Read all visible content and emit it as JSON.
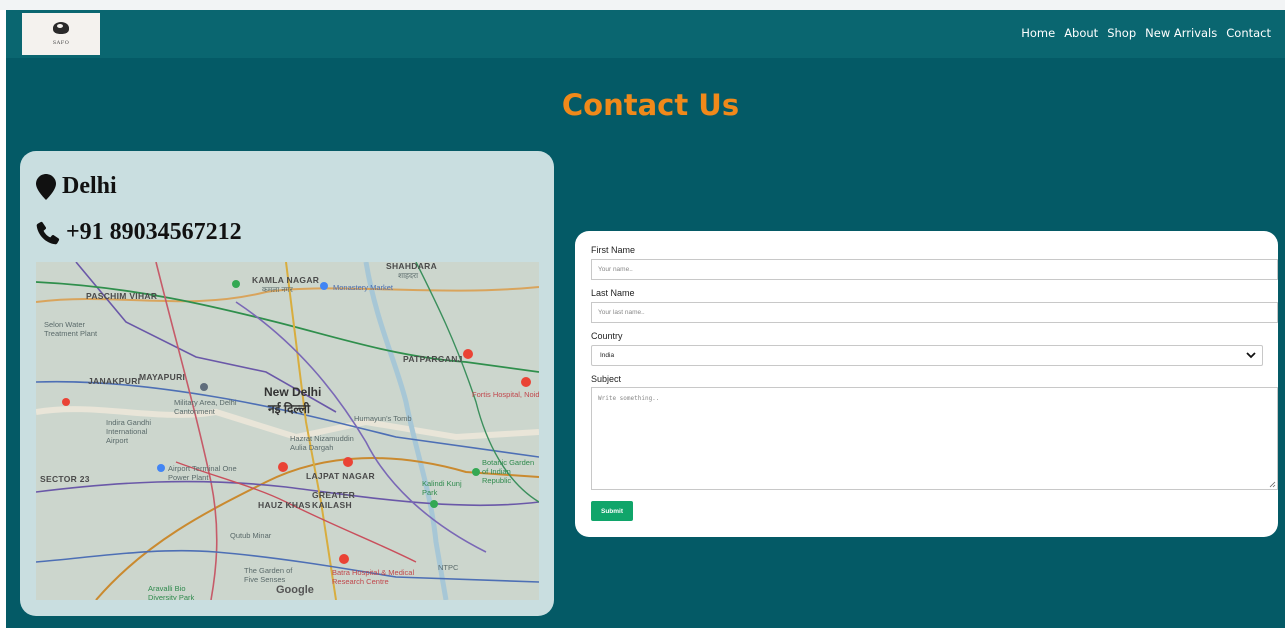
{
  "header": {
    "logo_text": "SAFO",
    "nav": [
      "Home",
      "About",
      "Shop",
      "New Arrivals",
      "Contact"
    ]
  },
  "page_title": "Contact Us",
  "info": {
    "city": "Delhi",
    "phone": "+91 89034567212",
    "map_labels": {
      "kamla_nagar": "KAMLA NAGAR",
      "kamla_nagar_hi": "कमला नगर",
      "shahdara": "SHAHDARA",
      "shahdara_hi": "शाहदरा",
      "paschim_vihar": "PASCHIM VIHAR",
      "monastery": "Monastery Market",
      "selon": "Selon Water Treatment Plant",
      "patparganj": "PATPARGANJ",
      "janakpuri": "JANAKPURI",
      "mayapuri": "MAYAPURI",
      "new_delhi": "New Delhi",
      "new_delhi_hi": "नई दिल्ली",
      "military": "Military Area, Delhi Cantonment",
      "airport": "Indira Gandhi International Airport",
      "humayun": "Humayun's Tomb",
      "nizamuddin": "Hazrat Nizamuddin Aulia Dargah",
      "fortis": "Fortis Hospital, Noida",
      "lajpat": "LAJPAT NAGAR",
      "greater_kailash": "GREATER KAILASH",
      "hauz_khas": "HAUZ KHAS",
      "airport_terminal": "Airport Terminal One Power Plant",
      "sector23": "SECTOR 23",
      "kalindi": "Kalindi Kunj Park",
      "botanic": "Botanic Garden of Indian Republic",
      "qutub": "Qutub Minar",
      "garden_senses": "The Garden of Five Senses",
      "batra": "Batra Hospital & Medical Research Centre",
      "ntpc": "NTPC",
      "aravalli": "Aravalli Bio Diversity Park",
      "google": "Google"
    }
  },
  "form": {
    "first_name_label": "First Name",
    "first_name_placeholder": "Your name..",
    "last_name_label": "Last Name",
    "last_name_placeholder": "Your last name..",
    "country_label": "Country",
    "country_value": "India",
    "subject_label": "Subject",
    "subject_placeholder": "Write something..",
    "submit_label": "Submit"
  }
}
